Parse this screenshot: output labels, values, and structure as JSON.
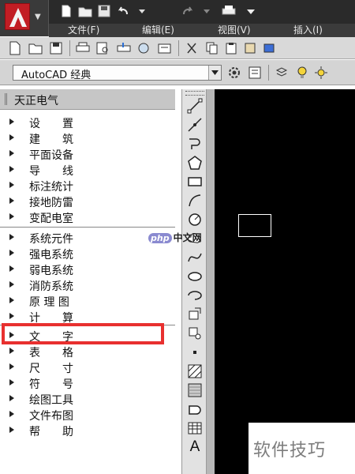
{
  "menubar": {
    "items": [
      "文件(F)",
      "编辑(E)",
      "视图(V)",
      "插入(I)"
    ]
  },
  "workspace": {
    "selected": "AutoCAD 经典"
  },
  "panel": {
    "title": "天正电气",
    "items": [
      "设　　置",
      "建　　筑",
      "平面设备",
      "导　　线",
      "标注统计",
      "接地防雷",
      "变配电室",
      "系统元件",
      "强电系统",
      "弱电系统",
      "消防系统",
      "原 理 图",
      "计　　算",
      "文　　字",
      "表　　格",
      "尺　　寸",
      "符　　号",
      "绘图工具",
      "文件布图",
      "帮　　助"
    ],
    "highlighted_item": "文　　字"
  },
  "draw_toolbar": {
    "text_tool_label": "A"
  },
  "watermark": {
    "center": "中文网",
    "logo": "php",
    "corner": "软件技巧"
  },
  "colors": {
    "highlight": "#e8302f",
    "canvas": "#000000",
    "menu_bg": "#3b3b3b",
    "logo_red": "#c21d24"
  }
}
